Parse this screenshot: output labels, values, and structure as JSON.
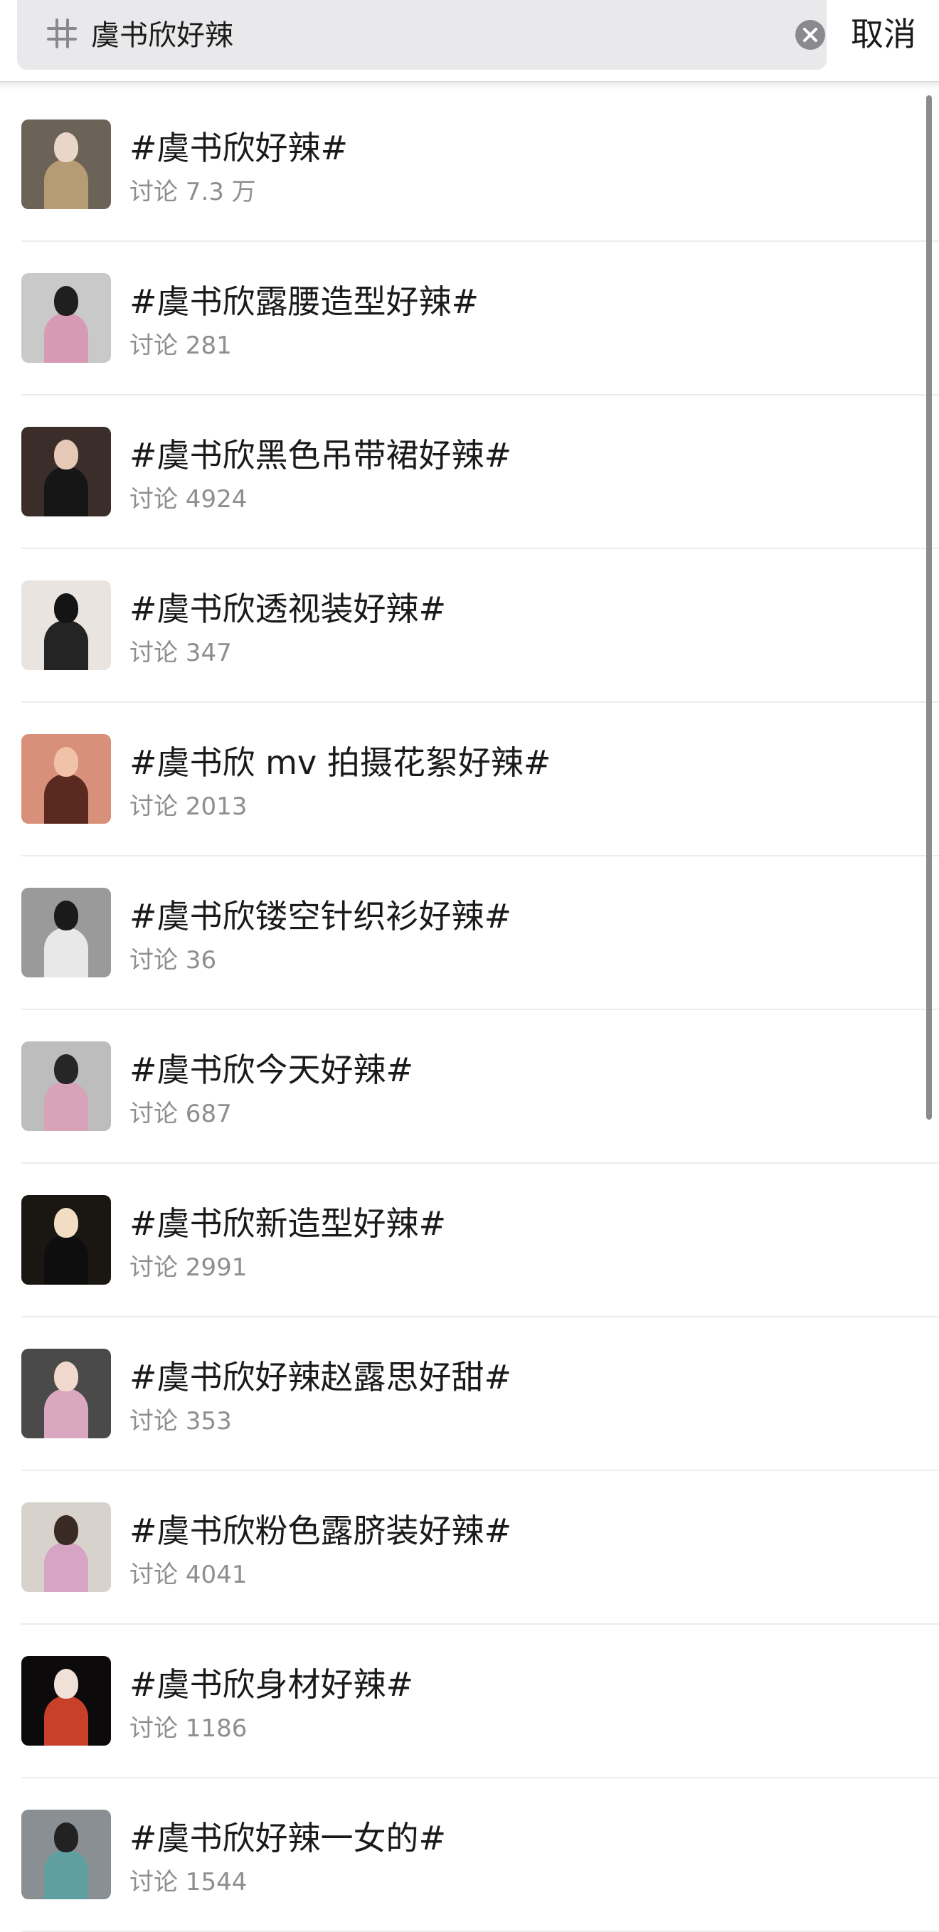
{
  "search": {
    "query": "虞书欣好辣",
    "cancel_label": "取消"
  },
  "icons": {
    "hash": "hash-icon",
    "clear": "clear-icon"
  },
  "colors": {
    "search_bg": "#e9e9eb",
    "meta_text": "#8e8e8e",
    "title_text": "#1a1a1a"
  },
  "topics": [
    {
      "title": "#虞书欣好辣#",
      "meta": "讨论 7.3 万",
      "thumb_bg": "#6b6258",
      "thumb_skin": "#e9d6c8",
      "thumb_cloth": "#b59c74"
    },
    {
      "title": "#虞书欣露腰造型好辣#",
      "meta": "讨论 281",
      "thumb_bg": "#c9c9c9",
      "thumb_skin": "#1f1f1f",
      "thumb_cloth": "#d79ab5"
    },
    {
      "title": "#虞书欣黑色吊带裙好辣#",
      "meta": "讨论 4924",
      "thumb_bg": "#3b2e2a",
      "thumb_skin": "#e6c8b6",
      "thumb_cloth": "#161616"
    },
    {
      "title": "#虞书欣透视装好辣#",
      "meta": "讨论 347",
      "thumb_bg": "#e9e4e0",
      "thumb_skin": "#141414",
      "thumb_cloth": "#242424"
    },
    {
      "title": "#虞书欣 mv 拍摄花絮好辣#",
      "meta": "讨论 2013",
      "thumb_bg": "#d8907a",
      "thumb_skin": "#f0c2a8",
      "thumb_cloth": "#5a2a20"
    },
    {
      "title": "#虞书欣镂空针织衫好辣#",
      "meta": "讨论 36",
      "thumb_bg": "#9a9a9a",
      "thumb_skin": "#1a1a1a",
      "thumb_cloth": "#e8e8e8"
    },
    {
      "title": "#虞书欣今天好辣#",
      "meta": "讨论 687",
      "thumb_bg": "#bdbdbd",
      "thumb_skin": "#262626",
      "thumb_cloth": "#d8a2b8"
    },
    {
      "title": "#虞书欣新造型好辣#",
      "meta": "讨论 2991",
      "thumb_bg": "#1a1612",
      "thumb_skin": "#f2ddc4",
      "thumb_cloth": "#0e0e0e"
    },
    {
      "title": "#虞书欣好辣赵露思好甜#",
      "meta": "讨论 353",
      "thumb_bg": "#4a4a4a",
      "thumb_skin": "#f0d8cc",
      "thumb_cloth": "#d9a8c0"
    },
    {
      "title": "#虞书欣粉色露脐装好辣#",
      "meta": "讨论 4041",
      "thumb_bg": "#d8d2cc",
      "thumb_skin": "#3a2a24",
      "thumb_cloth": "#d6a4c4"
    },
    {
      "title": "#虞书欣身材好辣#",
      "meta": "讨论 1186",
      "thumb_bg": "#0c0a0a",
      "thumb_skin": "#efe0d8",
      "thumb_cloth": "#c8402a"
    },
    {
      "title": "#虞书欣好辣一女的#",
      "meta": "讨论 1544",
      "thumb_bg": "#8a8f94",
      "thumb_skin": "#222222",
      "thumb_cloth": "#5f9fa0"
    }
  ]
}
